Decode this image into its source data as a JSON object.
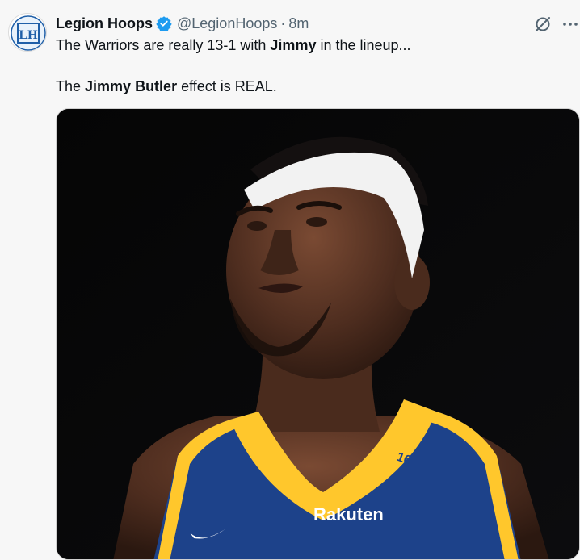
{
  "tweet": {
    "display_name": "Legion Hoops",
    "handle": "@LegionHoops",
    "separator": "·",
    "time": "8m",
    "line1": {
      "pre": "The Warriors are really 13-1 with ",
      "bold": "Jimmy",
      "post": " in the lineup..."
    },
    "line2": {
      "pre": "The ",
      "bold": "Jimmy Butler",
      "post": " effect is REAL."
    }
  },
  "avatar": {
    "logo_text": "LH"
  },
  "media": {
    "jersey_number": "16",
    "sponsor": "Rakuten"
  },
  "icons": {
    "verified": "verified-badge-icon",
    "grok": "grok-icon",
    "more": "more-icon"
  },
  "colors": {
    "verified": "#1d9bf0",
    "jersey_blue": "#1d428a",
    "jersey_gold": "#ffc72c"
  }
}
